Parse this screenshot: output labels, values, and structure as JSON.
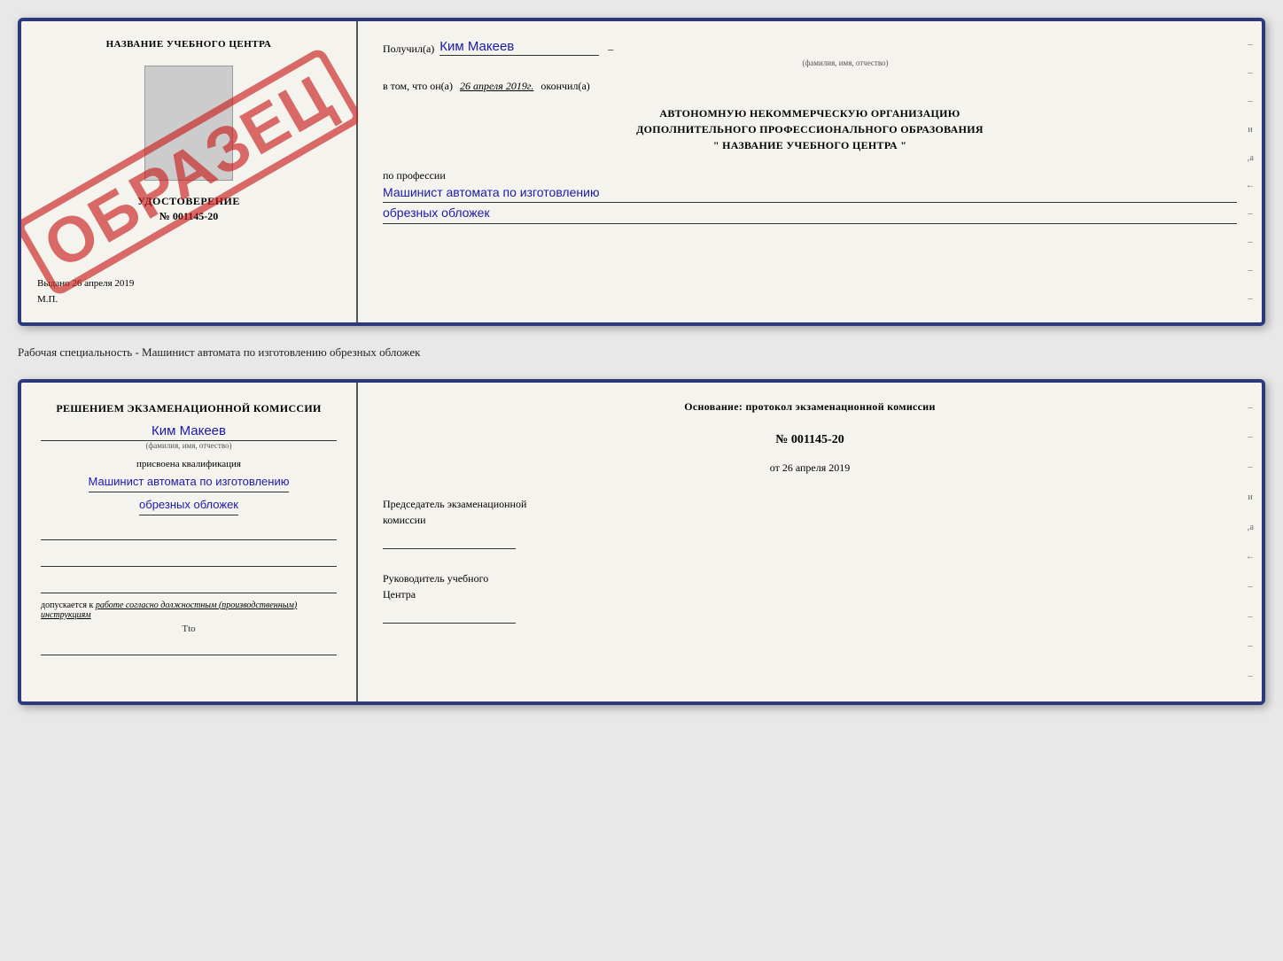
{
  "top_card": {
    "left": {
      "school_title": "НАЗВАНИЕ УЧЕБНОГО ЦЕНТРА",
      "stamp_text": "ОБРАЗЕЦ",
      "udostoverenie_label": "УДОСТОВЕРЕНИЕ",
      "number": "№ 001145-20",
      "vydano_label": "Выдано",
      "vydano_date": "26 апреля 2019",
      "mp_label": "М.П."
    },
    "right": {
      "poluchil_label": "Получил(а)",
      "recipient_name": "Ким Макеев",
      "fio_sublabel": "(фамилия, имя, отчество)",
      "vtom_label": "в том, что он(а)",
      "date_value": "26 апреля 2019г.",
      "okonchil_label": "окончил(а)",
      "org_line1": "АВТОНОМНУЮ НЕКОММЕРЧЕСКУЮ ОРГАНИЗАЦИЮ",
      "org_line2": "ДОПОЛНИТЕЛЬНОГО ПРОФЕССИОНАЛЬНОГО ОБРАЗОВАНИЯ",
      "org_name": "\" НАЗВАНИЕ УЧЕБНОГО ЦЕНТРА \"",
      "po_professii_label": "по профессии",
      "profession_line1": "Машинист автомата по изготовлению",
      "profession_line2": "обрезных обложек",
      "edge_marks": [
        "–",
        "–",
        "–",
        "и",
        "‚а",
        "←",
        "–",
        "–",
        "–",
        "–"
      ]
    }
  },
  "separator": {
    "text": "Рабочая специальность - Машинист автомата по изготовлению обрезных обложек"
  },
  "bottom_card": {
    "left": {
      "resheniem_line1": "Решением экзаменационной комиссии",
      "person_name": "Ким Макеев",
      "fio_sublabel": "(фамилия, имя, отчество)",
      "prisvoena_label": "присвоена квалификация",
      "profession_line1": "Машинист автомата по изготовлению",
      "profession_line2": "обрезных обложек",
      "допускается_text": "допускается к",
      "dopuskaetsya_value": "работе согласно должностным (производственным) инструкциям",
      "tto": "Tto"
    },
    "right": {
      "osnovaniye_label": "Основание: протокол экзаменационной комиссии",
      "protocol_number": "№ 001145-20",
      "ot_label": "от",
      "date_value": "26 апреля 2019",
      "predsedatel_line1": "Председатель экзаменационной",
      "predsedatel_line2": "комиссии",
      "rukovoditel_line1": "Руководитель учебного",
      "rukovoditel_line2": "Центра",
      "edge_marks": [
        "–",
        "–",
        "–",
        "и",
        "‚а",
        "←",
        "–",
        "–",
        "–",
        "–"
      ]
    }
  }
}
